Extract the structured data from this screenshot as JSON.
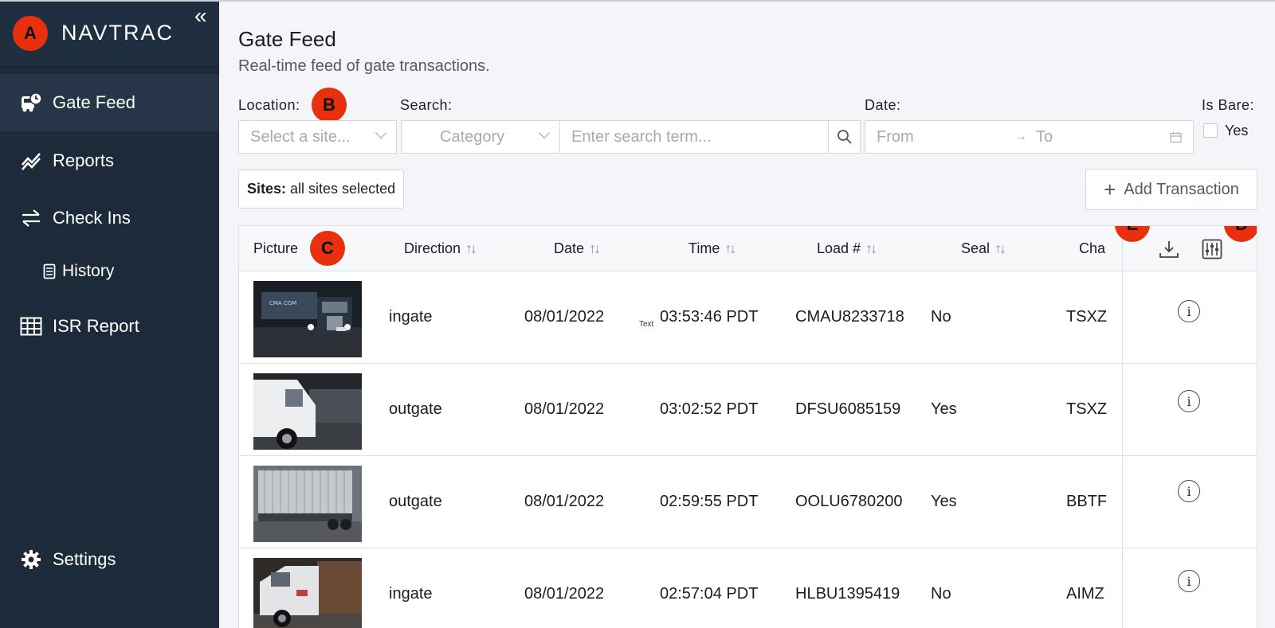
{
  "sidebar": {
    "badge": "A",
    "brand": "NAVTRAC",
    "collapse": "«",
    "items": [
      {
        "label": "Gate Feed"
      },
      {
        "label": "Reports"
      },
      {
        "label": "Check Ins"
      },
      {
        "label": "History"
      },
      {
        "label": "ISR Report"
      },
      {
        "label": "Settings"
      }
    ]
  },
  "header": {
    "title": "Gate Feed",
    "subtitle": "Real-time feed of gate transactions."
  },
  "filters": {
    "location_label": "Location:",
    "location_placeholder": "Select a site...",
    "search_label": "Search:",
    "category_placeholder": "Category",
    "search_placeholder": "Enter search term...",
    "date_label": "Date:",
    "date_from": "From",
    "date_arrow": "→",
    "date_to": "To",
    "isbare_label": "Is Bare:",
    "isbare_option": "Yes"
  },
  "sites": {
    "prefix": "Sites:",
    "value": "all sites selected"
  },
  "add_button": "Add Transaction",
  "badges": {
    "b": "B",
    "c": "C",
    "d": "D",
    "e": "E"
  },
  "table": {
    "columns": [
      "Picture",
      "Direction",
      "Date",
      "Time",
      "Load #",
      "Seal",
      "Cha"
    ],
    "sort_glyph": "↑↓",
    "stray_text": "Text",
    "rows": [
      {
        "direction": "ingate",
        "date": "08/01/2022",
        "time": "03:53:46 PDT",
        "load": "CMAU8233718",
        "seal": "No",
        "chassis": "TSXZ"
      },
      {
        "direction": "outgate",
        "date": "08/01/2022",
        "time": "03:02:52 PDT",
        "load": "DFSU6085159",
        "seal": "Yes",
        "chassis": "TSXZ"
      },
      {
        "direction": "outgate",
        "date": "08/01/2022",
        "time": "02:59:55 PDT",
        "load": "OOLU6780200",
        "seal": "Yes",
        "chassis": "BBTF"
      },
      {
        "direction": "ingate",
        "date": "08/01/2022",
        "time": "02:57:04 PDT",
        "load": "HLBU1395419",
        "seal": "No",
        "chassis": "AIMZ"
      }
    ],
    "info_glyph": "i"
  },
  "colors": {
    "sidebar": "#1c2a3a",
    "badge": "#e8300f",
    "background": "#f4f5f8"
  }
}
